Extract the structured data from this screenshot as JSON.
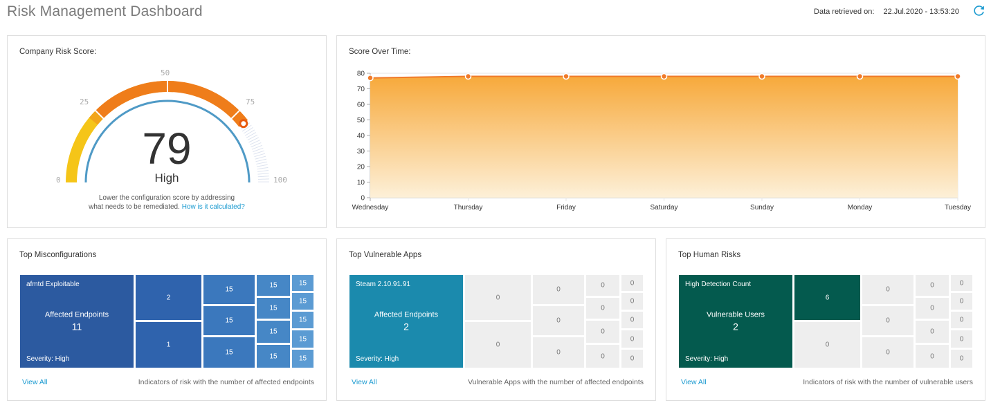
{
  "header": {
    "title": "Risk Management Dashboard",
    "retrieved_label": "Data retrieved on:",
    "retrieved_value": "22.Jul.2020 - 13:53:20"
  },
  "risk_score": {
    "title": "Company Risk Score:",
    "score": "79",
    "score_value": 79,
    "level": "High",
    "ticks": [
      "0",
      "25",
      "50",
      "75",
      "100"
    ],
    "text_line1": "Lower the configuration score by addressing",
    "text_line2": "what needs to be remediated.",
    "link": "How is it calculated?"
  },
  "score_over_time": {
    "title": "Score Over Time:",
    "chart_data": {
      "type": "area",
      "categories": [
        "Wednesday",
        "Thursday",
        "Friday",
        "Saturday",
        "Sunday",
        "Monday",
        "Tuesday"
      ],
      "values": [
        77,
        78,
        78,
        78,
        78,
        78,
        78
      ],
      "ylim": [
        0,
        80
      ],
      "yticks": [
        "0",
        "10",
        "20",
        "30",
        "40",
        "50",
        "60",
        "70",
        "80"
      ],
      "grid": true
    }
  },
  "misconfigurations": {
    "title": "Top Misconfigurations",
    "main_label": "afmtd Exploitable",
    "main_metric": "Affected Endpoints",
    "main_value": "11",
    "main_severity": "Severity: High",
    "cells": [
      "2",
      "1",
      "15",
      "15",
      "15",
      "15",
      "15",
      "15",
      "15",
      "15",
      "15",
      "15",
      "15",
      "15",
      "15"
    ],
    "view_all": "View All",
    "note": "Indicators of risk with the number of affected endpoints"
  },
  "vulnerable_apps": {
    "title": "Top Vulnerable Apps",
    "main_label": "Steam 2.10.91.91",
    "main_metric": "Affected Endpoints",
    "main_value": "2",
    "main_severity": "Severity: High",
    "cells": [
      "0",
      "0",
      "0",
      "0",
      "0",
      "0",
      "0",
      "0",
      "0",
      "0",
      "0",
      "0",
      "0",
      "0",
      "0"
    ],
    "view_all": "View All",
    "note": "Vulnerable Apps with the number of affected endpoints"
  },
  "human_risks": {
    "title": "Top Human Risks",
    "main_label": "High Detection Count",
    "main_metric": "Vulnerable Users",
    "main_value": "2",
    "main_severity": "Severity: High",
    "cells": [
      "6",
      "0",
      "0",
      "0",
      "0",
      "0",
      "0",
      "0",
      "0",
      "0",
      "0",
      "0",
      "0",
      "0",
      "0"
    ],
    "view_all": "View All",
    "note": "Indicators of risk with the number of vulnerable users"
  },
  "colors": {
    "gauge_yellow": "#f5c518",
    "gauge_orange": "#ef7d1a",
    "gauge_inner": "#4f9ac6",
    "chart_area": "#f7a93b",
    "misconfig_main": "#2c5aa0",
    "misconfig_mid": "#3b72b8",
    "misconfig_light": "#4a8ac8",
    "misconfig_lighter": "#5b9bd3",
    "apps_main": "#1b8aad",
    "apps_empty": "#eeeeee",
    "human_main": "#045a4e",
    "human_empty": "#eeeeee",
    "link": "#1a9ad0"
  },
  "icons": {
    "refresh": "refresh-icon"
  }
}
